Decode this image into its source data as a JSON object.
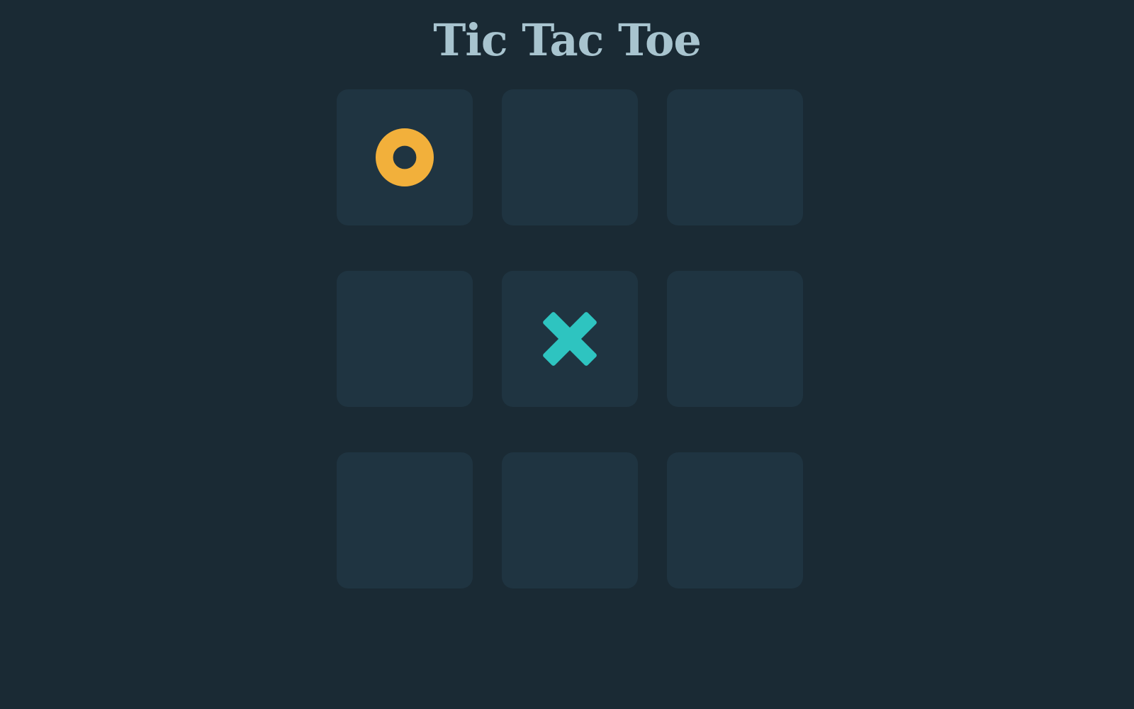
{
  "header": {
    "title": "Tic Tac Toe"
  },
  "colors": {
    "background": "#1a2a34",
    "cell": "#1f3441",
    "title": "#a8c4cf",
    "o_mark": "#f2b03b",
    "x_mark": "#2ec4c0"
  },
  "board": {
    "cells": [
      "O",
      "",
      "",
      "",
      "X",
      "",
      "",
      "",
      ""
    ]
  },
  "icons": {
    "o": "ring-o-icon",
    "x": "cross-x-icon"
  }
}
